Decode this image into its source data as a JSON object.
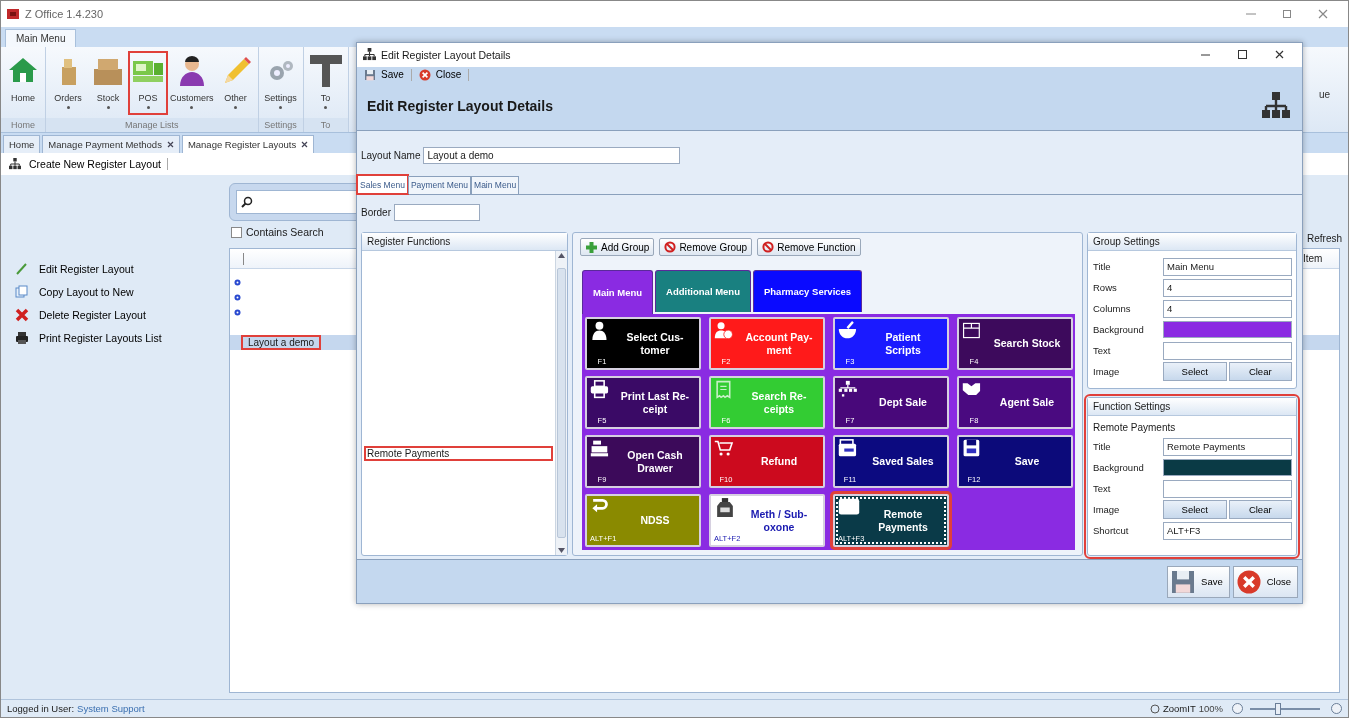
{
  "app": {
    "title": "Z Office 1.4.230"
  },
  "ribbon": {
    "tabs": [
      {
        "label": "Main Menu",
        "selected": true
      }
    ],
    "groups": [
      {
        "label": "Home",
        "buttons": [
          {
            "label": "Home",
            "kind": "home",
            "dropdown": false,
            "highlighted": false
          }
        ]
      },
      {
        "label": "Manage Lists",
        "buttons": [
          {
            "label": "Orders",
            "kind": "orders",
            "dropdown": true,
            "highlighted": false
          },
          {
            "label": "Stock",
            "kind": "stock",
            "dropdown": true,
            "highlighted": false
          },
          {
            "label": "POS",
            "kind": "pos",
            "dropdown": true,
            "highlighted": true
          },
          {
            "label": "Customers",
            "kind": "customers",
            "dropdown": true,
            "highlighted": false
          },
          {
            "label": "Other",
            "kind": "other",
            "dropdown": true,
            "highlighted": false
          }
        ]
      },
      {
        "label": "Settings",
        "buttons": [
          {
            "label": "Settings",
            "kind": "settings",
            "dropdown": true,
            "highlighted": false
          }
        ]
      },
      {
        "label": "To",
        "buttons": [
          {
            "label": "To",
            "kind": "tools",
            "dropdown": true,
            "highlighted": false
          }
        ]
      }
    ],
    "right_button": "ue"
  },
  "doc_tabs": [
    {
      "label": "Home",
      "closable": false,
      "selected": false
    },
    {
      "label": "Manage Payment Methods",
      "closable": true,
      "selected": false
    },
    {
      "label": "Manage Register Layouts",
      "closable": true,
      "selected": true
    }
  ],
  "toolbar": {
    "buttons": [
      {
        "label": "Create New Register Layout"
      }
    ]
  },
  "actions": [
    {
      "label": "Edit Register Layout",
      "kind": "edit"
    },
    {
      "label": "Copy Layout to New",
      "kind": "copy"
    },
    {
      "label": "Delete Register Layout",
      "kind": "delete"
    },
    {
      "label": "Print Register Layouts List",
      "kind": "print"
    }
  ],
  "search": {
    "contains_search": {
      "label": "Contains Search",
      "checked": false
    }
  },
  "grid": {
    "refresh": "Refresh",
    "columns": [
      "Item"
    ],
    "rows": [
      {
        "flagged": true,
        "selected": false
      },
      {
        "flagged": true,
        "selected": false
      },
      {
        "flagged": true,
        "selected": false
      },
      {
        "flagged": false,
        "selected": false
      },
      {
        "label": "Layout a demo",
        "flagged": false,
        "selected": true,
        "highlighted": true
      }
    ]
  },
  "status_bar": {
    "user_label": "Logged in User:",
    "user": "System Support",
    "zoom_label": "ZoomIT",
    "zoom": "100%",
    "level": 0.4
  },
  "dialog": {
    "title": "Edit Register Layout Details",
    "toolbar": [
      {
        "label": "Save",
        "kind": "save"
      },
      {
        "label": "Close",
        "kind": "close"
      }
    ],
    "heading": "Edit Register Layout Details",
    "layout_name": {
      "label": "Layout Name",
      "value": "Layout a demo"
    },
    "tabs": [
      {
        "label": "Sales Menu",
        "selected": true,
        "highlighted": true
      },
      {
        "label": "Payment Menu",
        "selected": false,
        "highlighted": false
      },
      {
        "label": "Main Menu",
        "selected": false,
        "highlighted": false
      }
    ],
    "border": {
      "label": "Border"
    },
    "functions": {
      "title": "Register Functions",
      "items": [
        {
          "label": "Remote Payments",
          "highlighted": true
        }
      ]
    },
    "group_toolbar": [
      {
        "label": "Add Group",
        "kind": "add"
      },
      {
        "label": "Remove Group",
        "kind": "remove"
      },
      {
        "label": "Remove Function",
        "kind": "remove"
      }
    ],
    "groups": [
      {
        "label": "Main Menu",
        "color": "#8a2be2",
        "selected": true
      },
      {
        "label": "Additional Menu",
        "color": "#198080",
        "selected": false
      },
      {
        "label": "Pharmacy Services",
        "color": "#0a0aff",
        "selected": false
      }
    ],
    "tiles": [
      {
        "title": "Select Cus-\ntomer",
        "shortcut": "F1",
        "color": "#000000",
        "selected": false,
        "highlighted": false
      },
      {
        "title": "Account Pay-\nment",
        "shortcut": "F2",
        "color": "#ff1a1a",
        "selected": false,
        "highlighted": false
      },
      {
        "title": "Patient\nScripts",
        "shortcut": "F3",
        "color": "#1a1aff",
        "selected": false,
        "highlighted": false
      },
      {
        "title": "Search Stock",
        "shortcut": "F4",
        "color": "#3d0a5c",
        "selected": false,
        "highlighted": false
      },
      {
        "title": "Print Last Re-\nceipt",
        "shortcut": "F5",
        "color": "#3a0a66",
        "selected": false,
        "highlighted": false
      },
      {
        "title": "Search Re-\nceipts",
        "shortcut": "F6",
        "color": "#33cc33",
        "selected": false,
        "highlighted": false
      },
      {
        "title": "Dept Sale",
        "shortcut": "F7",
        "color": "#48087a",
        "selected": false,
        "highlighted": false
      },
      {
        "title": "Agent Sale",
        "shortcut": "F8",
        "color": "#4a0a80",
        "selected": false,
        "highlighted": false
      },
      {
        "title": "Open Cash\nDrawer",
        "shortcut": "F9",
        "color": "#3c0a5a",
        "selected": false,
        "highlighted": false
      },
      {
        "title": "Refund",
        "shortcut": "F10",
        "color": "#cc0a1e",
        "selected": false,
        "highlighted": false
      },
      {
        "title": "Saved Sales",
        "shortcut": "F11",
        "color": "#0c0a80",
        "selected": false,
        "highlighted": false
      },
      {
        "title": "Save",
        "shortcut": "F12",
        "color": "#0c0a7a",
        "selected": false,
        "highlighted": false
      },
      {
        "title": "NDSS",
        "shortcut": "ALT+F1",
        "color": "#8a8a00",
        "selected": false,
        "highlighted": false
      },
      {
        "title": "Meth / Sub-\noxone",
        "shortcut": "ALT+F2",
        "color": "#ffffff",
        "selected": false,
        "highlighted": false
      },
      {
        "title": "Remote\nPayments",
        "shortcut": "ALT+F3",
        "color": "#0a3a48",
        "selected": true,
        "highlighted": true
      }
    ],
    "group_settings": {
      "title": "Group Settings",
      "highlighted": false,
      "fields": [
        {
          "label": "Title",
          "kind": "text",
          "value": "Main Menu"
        },
        {
          "label": "Rows",
          "kind": "text",
          "value": "4"
        },
        {
          "label": "Columns",
          "kind": "text",
          "value": "4"
        },
        {
          "label": "Background",
          "kind": "color",
          "color": "#8a2be2"
        },
        {
          "label": "Text",
          "kind": "text"
        },
        {
          "label": "Image",
          "kind": "buttons",
          "buttons": [
            "Select",
            "Clear"
          ]
        }
      ]
    },
    "function_settings": {
      "title": "Function Settings",
      "subtitle": "Remote Payments",
      "highlighted": true,
      "fields": [
        {
          "label": "Title",
          "kind": "text",
          "value": "Remote Payments"
        },
        {
          "label": "Background",
          "kind": "color",
          "color": "#0a3a45"
        },
        {
          "label": "Text",
          "kind": "text"
        },
        {
          "label": "Image",
          "kind": "buttons",
          "buttons": [
            "Select",
            "Clear"
          ]
        },
        {
          "label": "Shortcut",
          "kind": "text",
          "value": "ALT+F3"
        }
      ]
    },
    "footer": [
      {
        "label": "Save",
        "kind": "save"
      },
      {
        "label": "Close",
        "kind": "close"
      }
    ]
  }
}
